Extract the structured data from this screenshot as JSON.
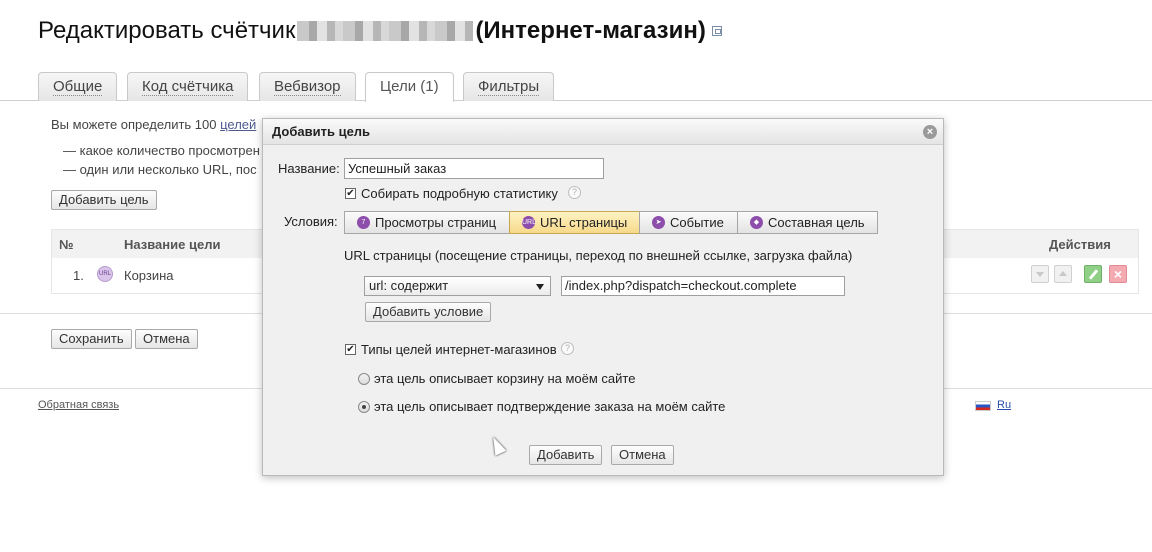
{
  "page": {
    "title_prefix": "Редактировать счётчик",
    "title_suffix": "(Интернет-магазин)"
  },
  "tabs": [
    {
      "label": "Общие"
    },
    {
      "label": "Код счётчика"
    },
    {
      "label": "Вебвизор"
    },
    {
      "label": "Цели (1)",
      "active": true
    },
    {
      "label": "Фильтры"
    }
  ],
  "goals_page": {
    "intro_text": "Вы можете определить 100",
    "intro_link": "целей",
    "bullets": [
      "— какое количество просмотрен",
      "— один или несколько URL, пос"
    ],
    "add_goal_button": "Добавить цель",
    "table": {
      "headers": {
        "num": "№",
        "name": "Название цели",
        "actions": "Действия"
      },
      "rows": [
        {
          "num": "1.",
          "icon": "url-goal-icon",
          "name": "Корзина"
        }
      ]
    },
    "save_button": "Сохранить",
    "cancel_button": "Отмена"
  },
  "footer": {
    "feedback_link": "Обратная связь",
    "language": "Ru"
  },
  "modal": {
    "title": "Добавить цель",
    "name_label": "Название:",
    "name_value": "Успешный заказ",
    "detailed_stats_label": "Собирать подробную статистику",
    "detailed_stats_checked": true,
    "conditions_label": "Условия:",
    "condition_types": [
      {
        "label": "Просмотры страниц",
        "icon": "page-views-icon"
      },
      {
        "label": "URL страницы",
        "icon": "url-icon",
        "active": true
      },
      {
        "label": "Событие",
        "icon": "event-cursor-icon"
      },
      {
        "label": "Составная цель",
        "icon": "composite-goal-icon"
      }
    ],
    "url_description": "URL страницы (посещение страницы, переход по внешней ссылке, загрузка файла)",
    "match_type_selected": "url: содержит",
    "url_value": "/index.php?dispatch=checkout.complete",
    "add_condition_button": "Добавить условие",
    "ecommerce_label": "Типы целей интернет-магазинов",
    "ecommerce_checked": true,
    "radio_options": [
      {
        "label": "эта цель описывает корзину на моём сайте",
        "checked": false
      },
      {
        "label": "эта цель описывает подтверждение заказа на моём сайте",
        "checked": true
      }
    ],
    "add_button": "Добавить",
    "cancel_button": "Отмена",
    "help_glyph": "?",
    "close_glyph": "×",
    "check_glyph": "✔"
  },
  "colors": {
    "link": "#4e5a8f",
    "active_tab_bg": "#f6d98b",
    "goal_icon": "#8c4dab"
  }
}
